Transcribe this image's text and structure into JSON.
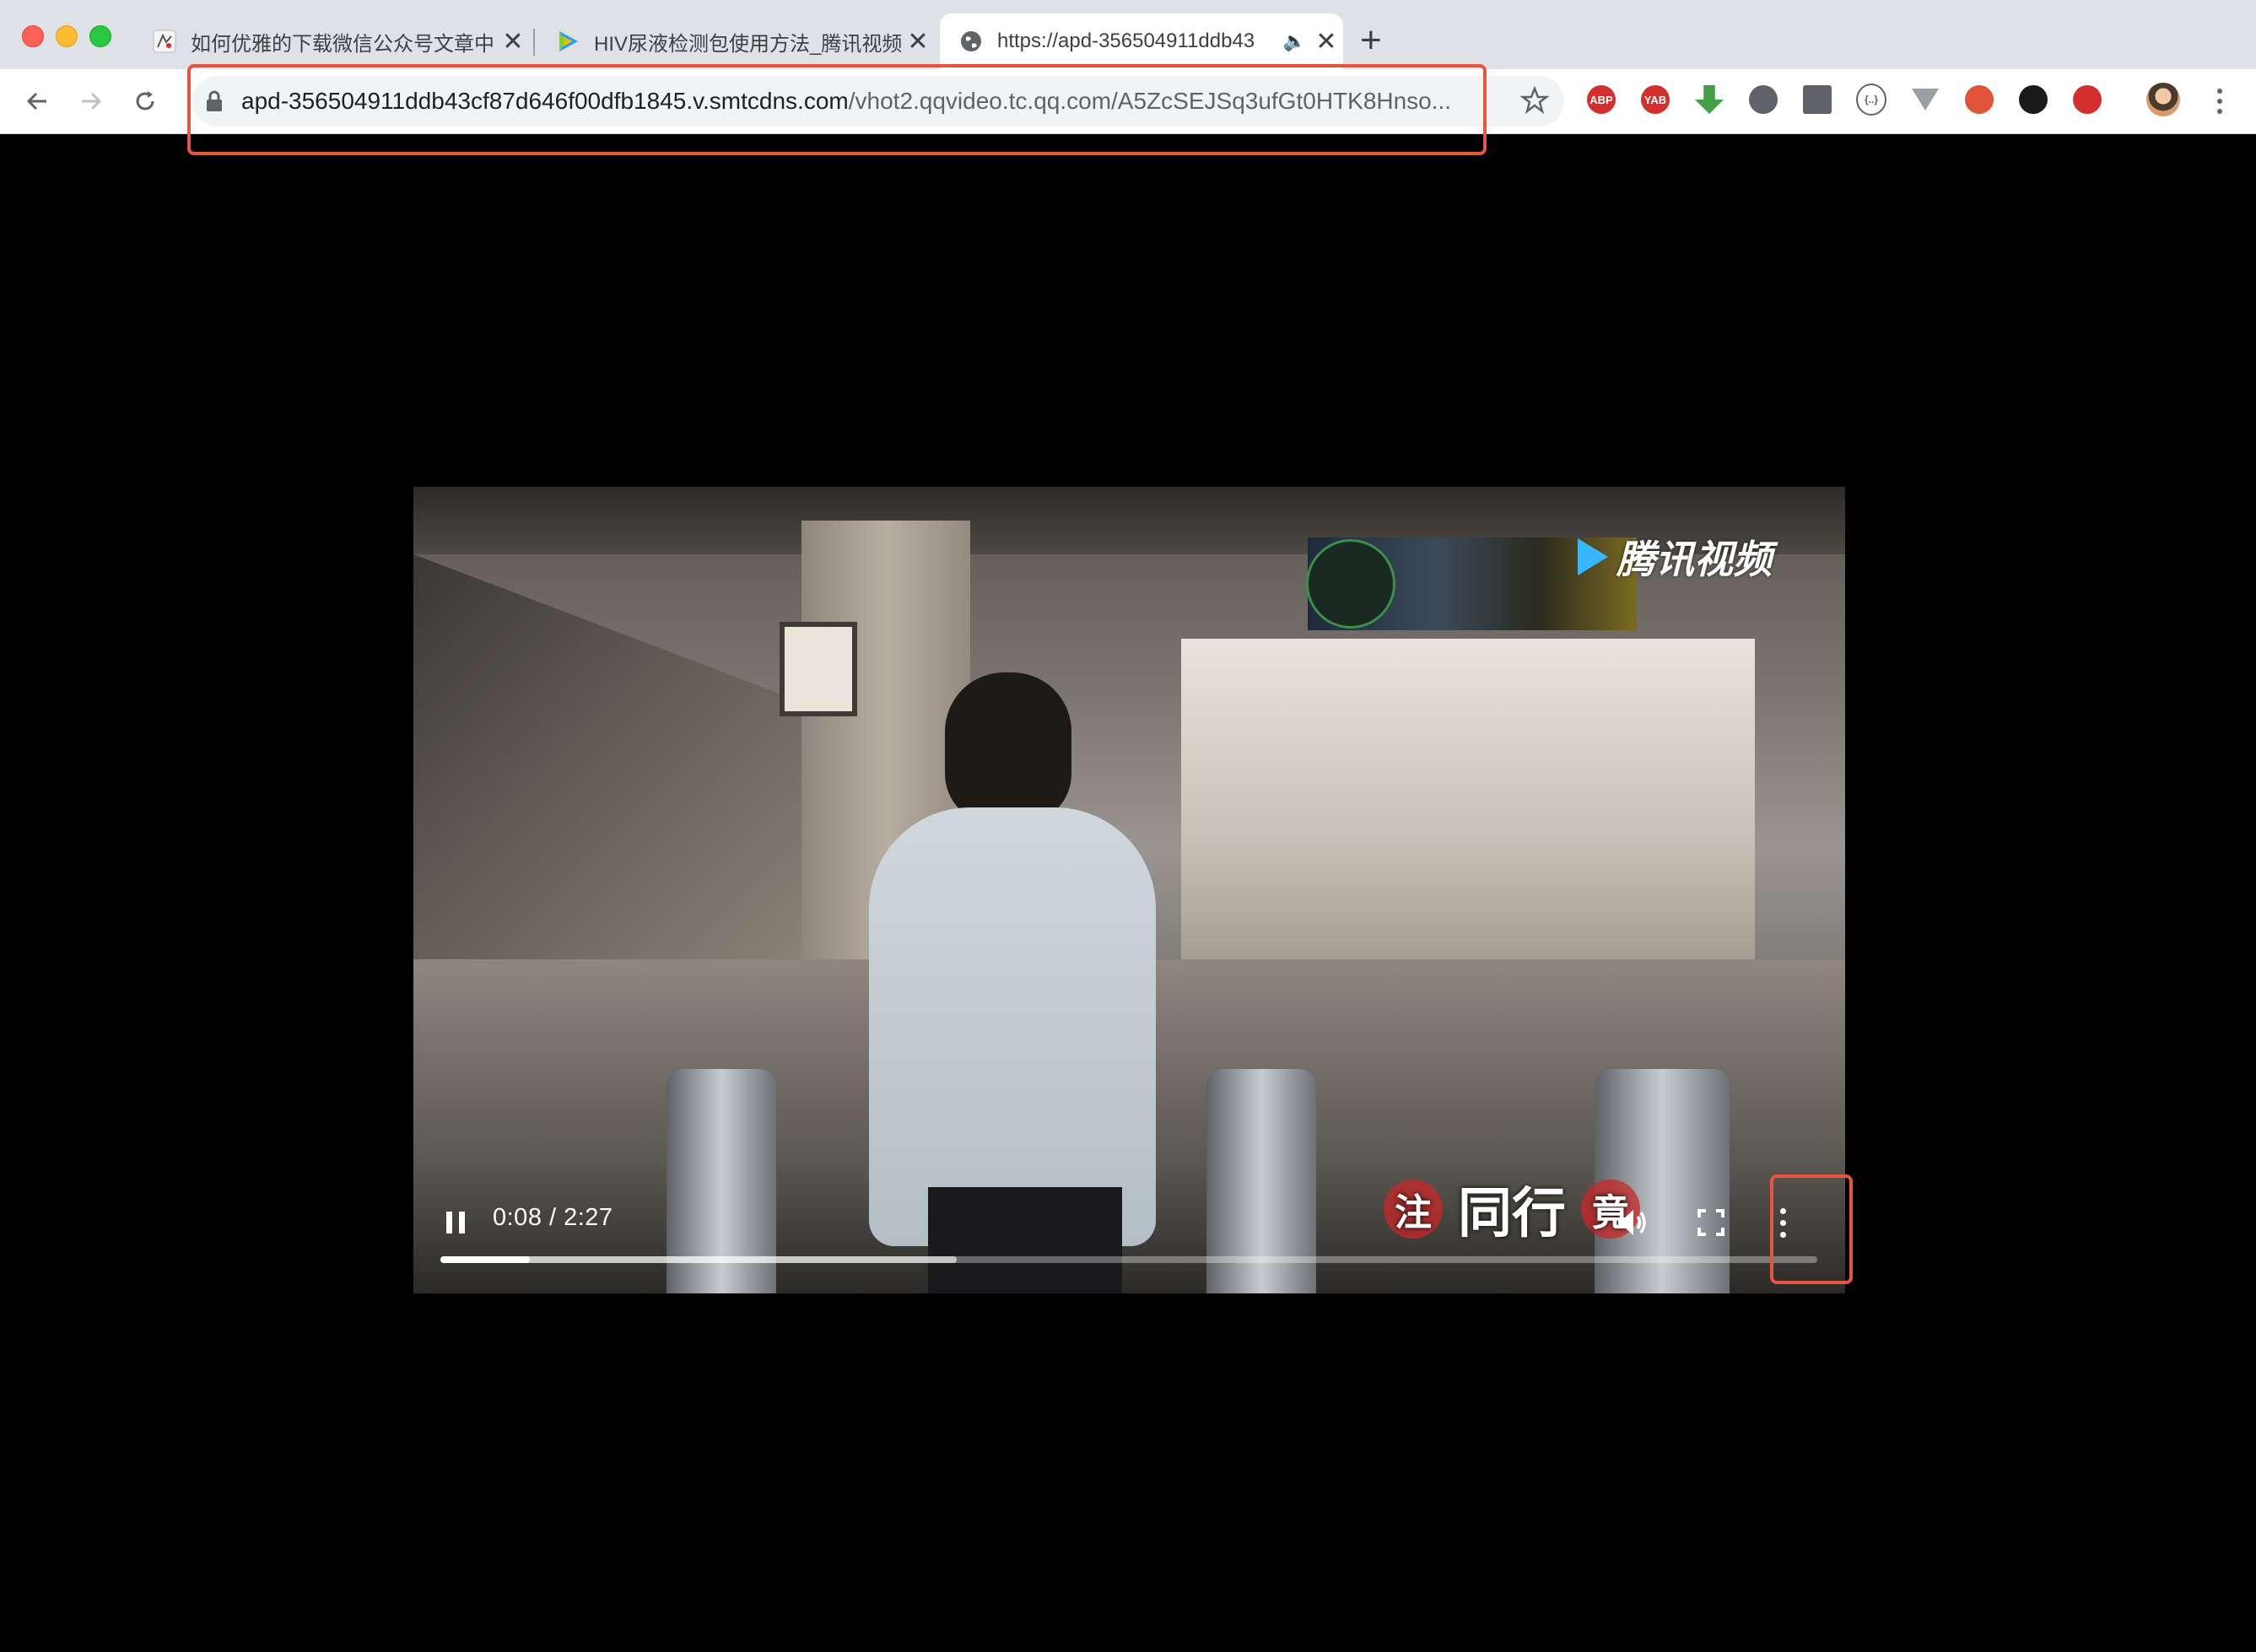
{
  "window": {
    "tabs": [
      {
        "title": "如何优雅的下载微信公众号文章中",
        "favicon": "site-favicon-icon"
      },
      {
        "title": "HIV尿液检测包使用方法_腾讯视频",
        "favicon": "tencent-video-favicon-icon"
      },
      {
        "title": "https://apd-356504911ddb43",
        "favicon": "globe-icon",
        "audio": true
      }
    ],
    "new_tab_label": "+"
  },
  "toolbar": {
    "url_host": "apd-356504911ddb43cf87d646f00dfb1845.v.smtcdns.com",
    "url_path": "/vhot2.qqvideo.tc.qq.com/A5ZcSEJSq3ufGt0HTK8Hnso...",
    "extensions": [
      {
        "name": "adblock-plus-icon",
        "label": "ABP",
        "color": "#d32f2f"
      },
      {
        "name": "yab-icon",
        "label": "YAB",
        "color": "#d32f2f"
      },
      {
        "name": "download-arrow-icon",
        "label": "",
        "color": "#43a047"
      },
      {
        "name": "gear-extension-icon",
        "label": "",
        "color": "#5f6368"
      },
      {
        "name": "calendar-extension-icon",
        "label": "",
        "color": "#5f6368"
      },
      {
        "name": "code-braces-icon",
        "label": "{..}",
        "color": "#5f6368"
      },
      {
        "name": "vue-devtools-icon",
        "label": "",
        "color": "#9aa0a6"
      },
      {
        "name": "proxy-switch-icon",
        "label": "",
        "color": "#e0543a"
      },
      {
        "name": "lightbulb-extension-icon",
        "label": "",
        "color": "#1a1a1a"
      },
      {
        "name": "virus-extension-icon",
        "label": "",
        "color": "#d32f2f"
      }
    ]
  },
  "video": {
    "watermark": "腾讯视频",
    "subtitle_stamp_left": "注",
    "subtitle_text": "同行",
    "subtitle_stamp_right": "竟",
    "current_time": "0:08",
    "duration": "2:27",
    "time_display": "0:08 / 2:27",
    "played_fraction": 0.065,
    "buffered_fraction": 0.375
  },
  "colors": {
    "annotation": "#e8553e",
    "tabstrip": "#dee1e6",
    "omnibox": "#f1f3f4"
  }
}
